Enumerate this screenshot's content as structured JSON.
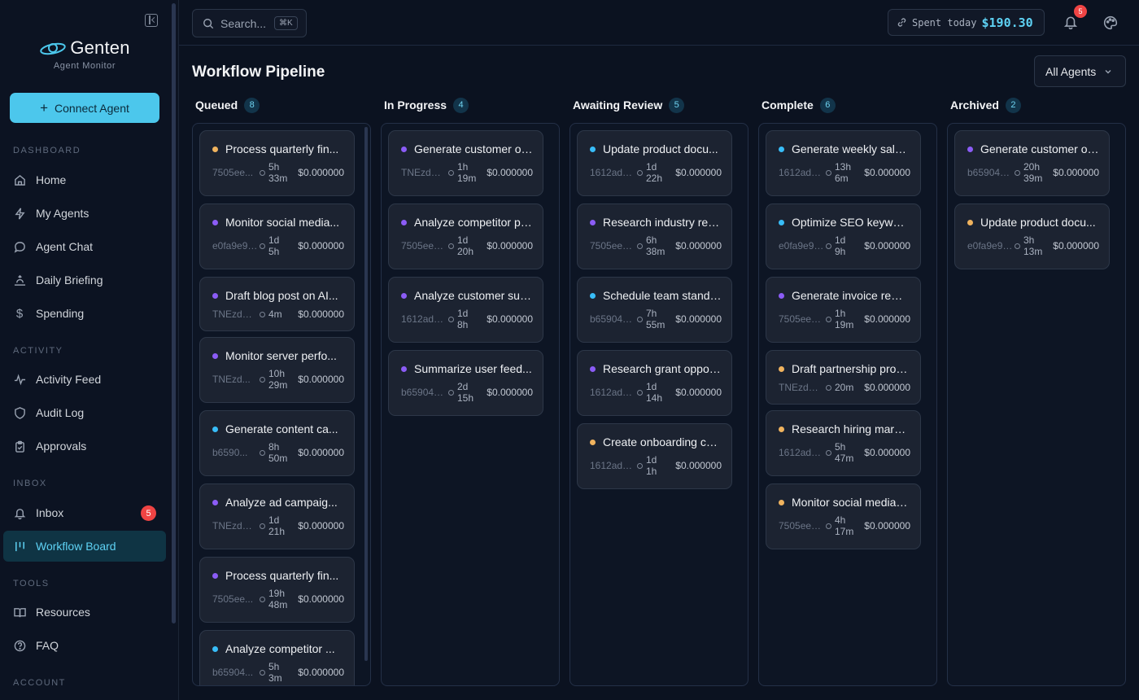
{
  "sidebar": {
    "brand_name": "Genten",
    "brand_sub": "Agent Monitor",
    "connect_label": "Connect Agent",
    "sections": {
      "dashboard": "DASHBOARD",
      "activity": "ACTIVITY",
      "inbox": "INBOX",
      "tools": "TOOLS",
      "account": "ACCOUNT"
    },
    "items": {
      "home": "Home",
      "my_agents": "My Agents",
      "agent_chat": "Agent Chat",
      "daily_briefing": "Daily Briefing",
      "spending": "Spending",
      "activity_feed": "Activity Feed",
      "audit_log": "Audit Log",
      "approvals": "Approvals",
      "inbox": "Inbox",
      "inbox_badge": "5",
      "workflow_board": "Workflow Board",
      "resources": "Resources",
      "faq": "FAQ"
    }
  },
  "topbar": {
    "search_placeholder": "Search...",
    "search_kbd": "⌘K",
    "spent_label": "Spent today",
    "spent_value": "$190.30",
    "notif_count": "5"
  },
  "page": {
    "title": "Workflow Pipeline",
    "agent_filter": "All Agents"
  },
  "columns": [
    {
      "title": "Queued",
      "count": "8",
      "cards": [
        {
          "title": "Process quarterly fin...",
          "id": "7505ee...",
          "dur1": "5h",
          "dur2": "33m",
          "cost": "$0.000000",
          "color": "amber"
        },
        {
          "title": "Monitor social media...",
          "id": "e0fa9e9b...",
          "dur1": "1d",
          "dur2": "5h",
          "cost": "$0.000000",
          "color": "purple"
        },
        {
          "title": "Draft blog post on AI...",
          "id": "TNEzdOl...",
          "dur1": "4m",
          "dur2": "",
          "cost": "$0.000000",
          "color": "purple"
        },
        {
          "title": "Monitor server perfo...",
          "id": "TNEzd...",
          "dur1": "10h",
          "dur2": "29m",
          "cost": "$0.000000",
          "color": "purple"
        },
        {
          "title": "Generate content ca...",
          "id": "b6590...",
          "dur1": "8h",
          "dur2": "50m",
          "cost": "$0.000000",
          "color": "cyan"
        },
        {
          "title": "Analyze ad campaig...",
          "id": "TNEzdOl...",
          "dur1": "1d",
          "dur2": "21h",
          "cost": "$0.000000",
          "color": "purple"
        },
        {
          "title": "Process quarterly fin...",
          "id": "7505ee...",
          "dur1": "19h",
          "dur2": "48m",
          "cost": "$0.000000",
          "color": "purple"
        },
        {
          "title": "Analyze competitor ...",
          "id": "b65904...",
          "dur1": "5h",
          "dur2": "3m",
          "cost": "$0.000000",
          "color": "cyan"
        }
      ]
    },
    {
      "title": "In Progress",
      "count": "4",
      "cards": [
        {
          "title": "Generate customer ou...",
          "id": "TNEzdOlx...",
          "dur1": "1h",
          "dur2": "19m",
          "cost": "$0.000000",
          "color": "purple"
        },
        {
          "title": "Analyze competitor pr...",
          "id": "7505eec3...",
          "dur1": "1d",
          "dur2": "20h",
          "cost": "$0.000000",
          "color": "purple"
        },
        {
          "title": "Analyze customer sup...",
          "id": "1612add8-1...",
          "dur1": "1d",
          "dur2": "8h",
          "cost": "$0.000000",
          "color": "purple"
        },
        {
          "title": "Summarize user feed...",
          "id": "b6590464...",
          "dur1": "2d",
          "dur2": "15h",
          "cost": "$0.000000",
          "color": "purple"
        }
      ]
    },
    {
      "title": "Awaiting Review",
      "count": "5",
      "cards": [
        {
          "title": "Update product docu...",
          "id": "1612add8...",
          "dur1": "1d",
          "dur2": "22h",
          "cost": "$0.000000",
          "color": "cyan"
        },
        {
          "title": "Research industry reg...",
          "id": "7505eec...",
          "dur1": "6h",
          "dur2": "38m",
          "cost": "$0.000000",
          "color": "purple"
        },
        {
          "title": "Schedule team standu...",
          "id": "b659046...",
          "dur1": "7h",
          "dur2": "55m",
          "cost": "$0.000000",
          "color": "cyan"
        },
        {
          "title": "Research grant oppor...",
          "id": "1612add8-...",
          "dur1": "1d",
          "dur2": "14h",
          "cost": "$0.000000",
          "color": "purple"
        },
        {
          "title": "Create onboarding ch...",
          "id": "1612add8-1...",
          "dur1": "1d",
          "dur2": "1h",
          "cost": "$0.000000",
          "color": "amber"
        }
      ]
    },
    {
      "title": "Complete",
      "count": "6",
      "cards": [
        {
          "title": "Generate weekly sales...",
          "id": "1612add8-...",
          "dur1": "13h",
          "dur2": "6m",
          "cost": "$0.000000",
          "color": "cyan"
        },
        {
          "title": "Optimize SEO keywords",
          "id": "e0fa9e9b-...",
          "dur1": "1d",
          "dur2": "9h",
          "cost": "$0.000000",
          "color": "cyan"
        },
        {
          "title": "Generate invoice remi...",
          "id": "7505eec3...",
          "dur1": "1h",
          "dur2": "19m",
          "cost": "$0.000000",
          "color": "purple"
        },
        {
          "title": "Draft partnership prop...",
          "id": "TNEzdOl...",
          "dur1": "20m",
          "dur2": "",
          "cost": "$0.000000",
          "color": "amber"
        },
        {
          "title": "Research hiring marke...",
          "id": "1612add8...",
          "dur1": "5h",
          "dur2": "47m",
          "cost": "$0.000000",
          "color": "amber"
        },
        {
          "title": "Monitor social media s...",
          "id": "7505eec3...",
          "dur1": "4h",
          "dur2": "17m",
          "cost": "$0.000000",
          "color": "amber"
        }
      ]
    },
    {
      "title": "Archived",
      "count": "2",
      "cards": [
        {
          "title": "Generate customer ou...",
          "id": "b659046...",
          "dur1": "20h",
          "dur2": "39m",
          "cost": "$0.000000",
          "color": "purple"
        },
        {
          "title": "Update product docu...",
          "id": "e0fa9e9b...",
          "dur1": "3h",
          "dur2": "13m",
          "cost": "$0.000000",
          "color": "amber"
        }
      ]
    }
  ]
}
